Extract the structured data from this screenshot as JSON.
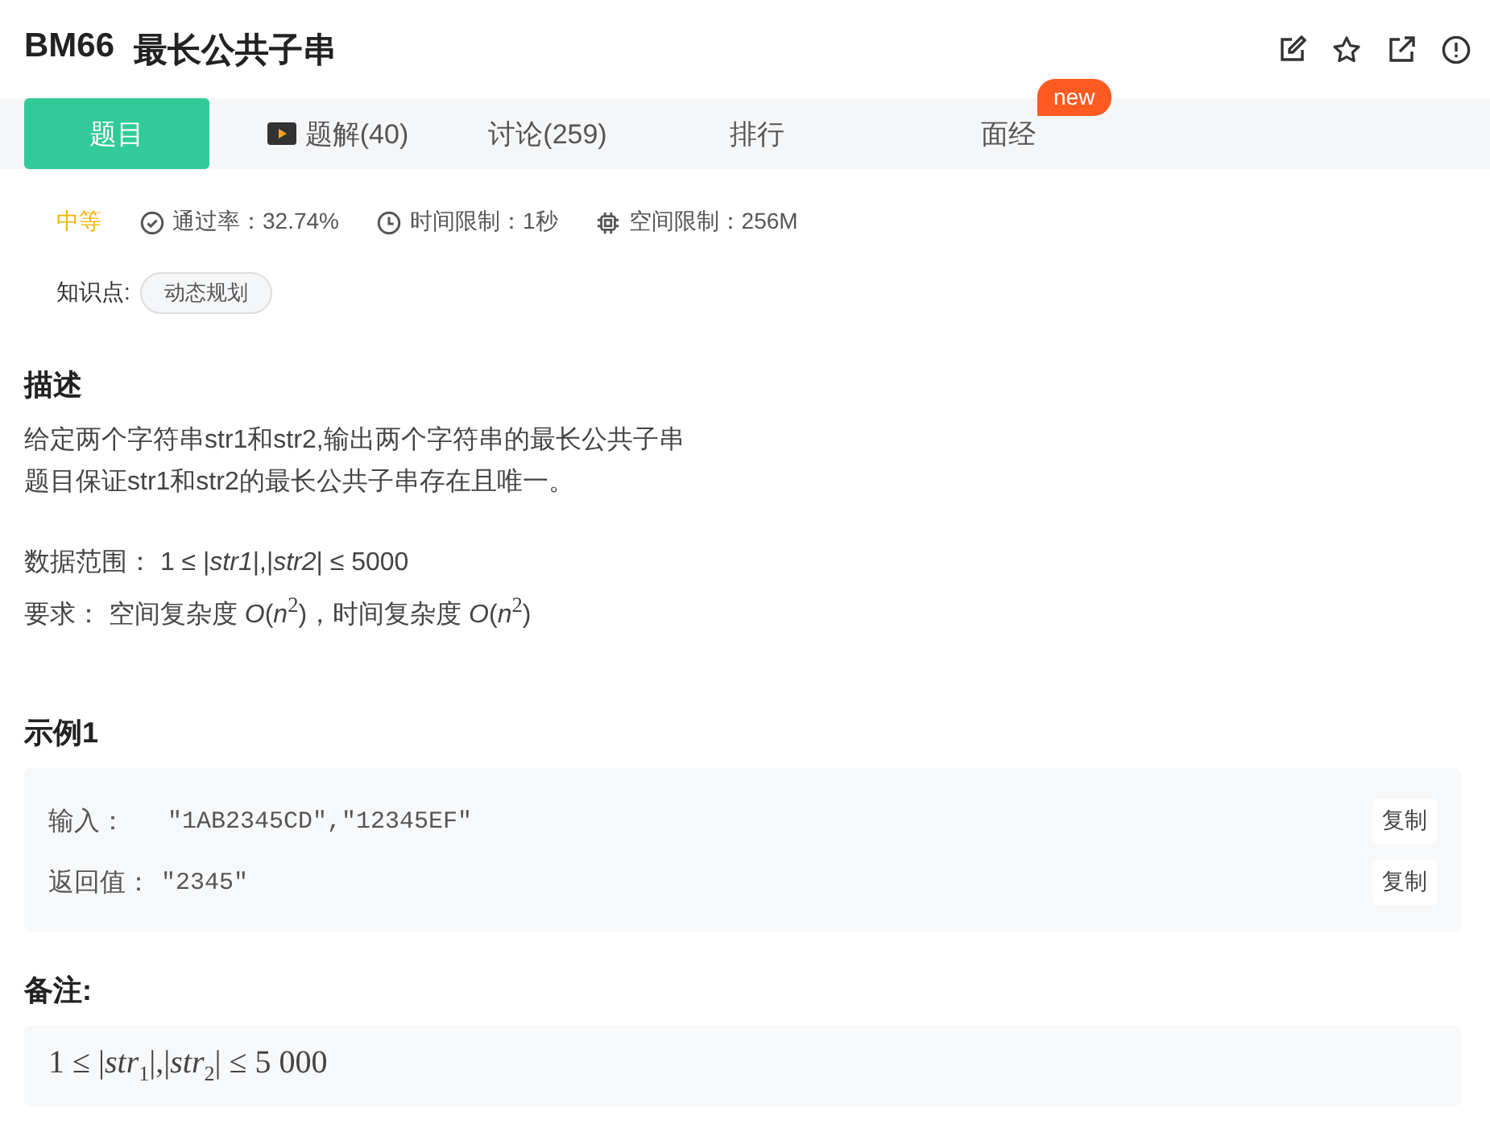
{
  "title": {
    "code": "BM66",
    "name": "最长公共子串"
  },
  "tabs": [
    {
      "label": "题目",
      "selected": true,
      "kind": "plain"
    },
    {
      "label": "题解(40)",
      "selected": false,
      "kind": "video"
    },
    {
      "label": "讨论(259)",
      "selected": false,
      "kind": "plain"
    },
    {
      "label": "排行",
      "selected": false,
      "kind": "plain"
    },
    {
      "label": "面经",
      "selected": false,
      "kind": "plain",
      "badge": "new"
    }
  ],
  "meta": {
    "difficulty": "中等",
    "pass_rate": "通过率：32.74%",
    "time_limit": "时间限制：1秒",
    "space_limit": "空间限制：256M"
  },
  "knowledge": {
    "label": "知识点:",
    "tags": [
      "动态规划"
    ]
  },
  "description": {
    "heading": "描述",
    "paragraphs": [
      [
        "给定两个字符串str1和str2,输出两个字符串的最长公共子串",
        "题目保证str1和str2的最长公共子串存在且唯一。"
      ],
      [
        "数据范围： 1 ≤ |*str1*|,|*str2*| ≤ 5000",
        "要求： 空间复杂度 *O*(*n*$^{2}$)，时间复杂度 *O*(*n*$^{2}$)"
      ]
    ]
  },
  "example": {
    "heading": "示例1",
    "rows": [
      {
        "label": "输入：",
        "value": "\"1AB2345CD\",\"12345EF\"",
        "button": "复制"
      },
      {
        "label": "返回值：",
        "value": "\"2345\"",
        "button": "复制"
      }
    ]
  },
  "note": {
    "heading": "备注:",
    "text": "1 ≤ |*str*$_{1}$|,|*str*$_{2}$| ≤ 5 000"
  }
}
